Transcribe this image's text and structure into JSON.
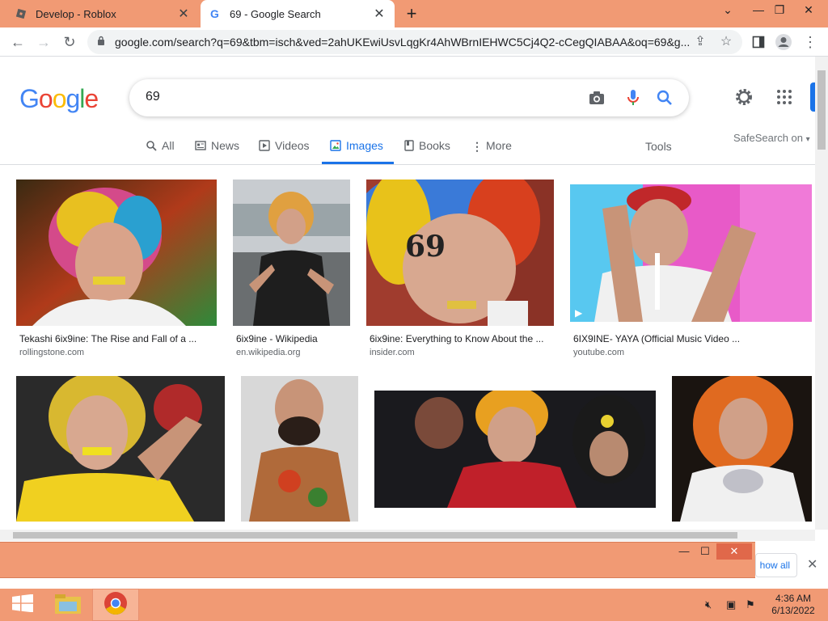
{
  "browser": {
    "tabs": [
      {
        "title": "Develop - Roblox",
        "active": false
      },
      {
        "title": "69 - Google Search",
        "active": true
      }
    ],
    "url": "google.com/search?q=69&tbm=isch&ved=2ahUKEwiUsvLqgKr4AhWBrnIEHWC5Cj4Q2-cCegQIABAA&oq=69&g..."
  },
  "google": {
    "logo": "Google",
    "query": "69",
    "tabs": [
      "All",
      "News",
      "Videos",
      "Images",
      "Books",
      "More"
    ],
    "selected_tab": "Images",
    "tools": "Tools",
    "safesearch": "SafeSearch on"
  },
  "results": [
    {
      "caption": "Tekashi 6ix9ine: The Rise and Fall of a ...",
      "source": "rollingstone.com"
    },
    {
      "caption": "6ix9ine - Wikipedia",
      "source": "en.wikipedia.org"
    },
    {
      "caption": "6ix9ine: Everything to Know About the ...",
      "source": "insider.com"
    },
    {
      "caption": "6IX9INE- YAYA (Official Music Video ...",
      "source": "youtube.com"
    }
  ],
  "download_bar": {
    "show_all": "how all"
  },
  "taskbar": {
    "time": "4:36 AM",
    "date": "6/13/2022"
  },
  "colors": {
    "accent": "#f19a74",
    "google_blue": "#1a73e8"
  }
}
